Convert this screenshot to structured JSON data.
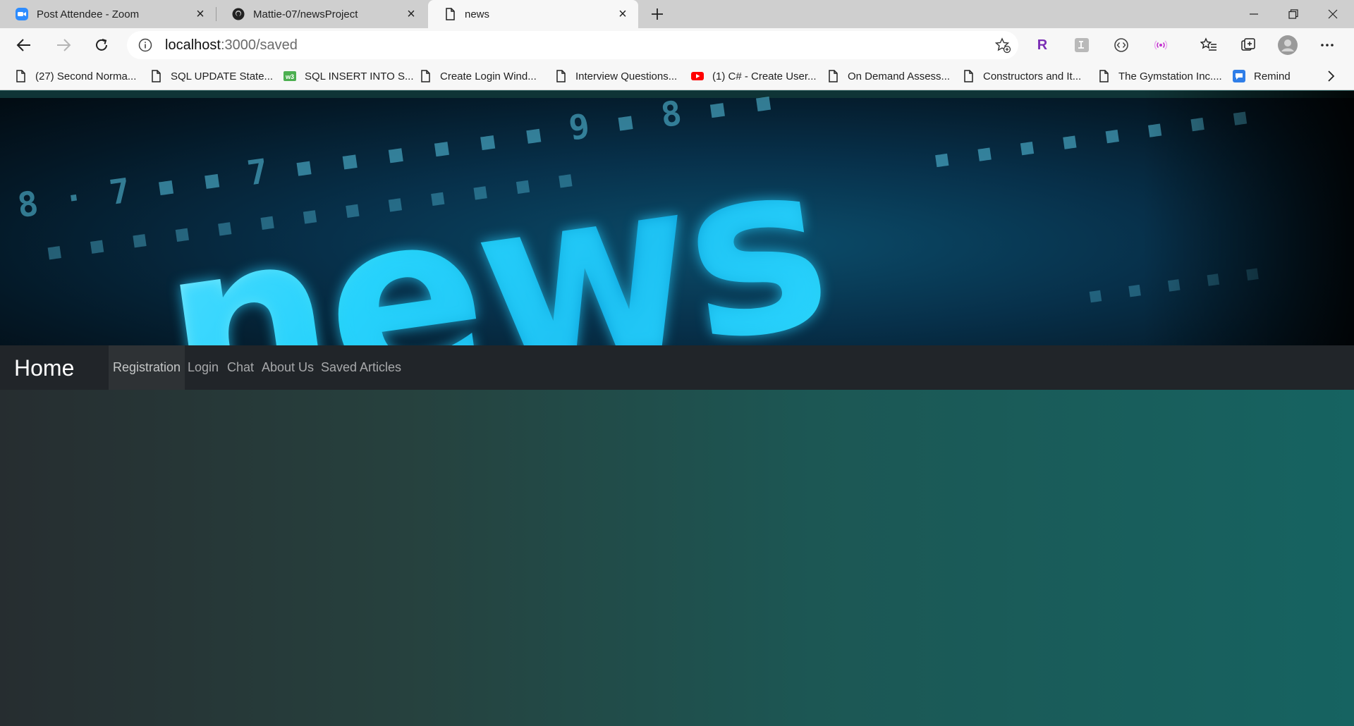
{
  "browser": {
    "tabs": [
      {
        "title": "Post Attendee - Zoom",
        "icon": "zoom-icon"
      },
      {
        "title": "Mattie-07/newsProject",
        "icon": "github-icon"
      },
      {
        "title": "news",
        "icon": "page-icon"
      }
    ],
    "address": {
      "host": "localhost",
      "path": ":3000/saved"
    },
    "bookmarks": [
      {
        "label": "(27) Second Norma...",
        "icon": "page-icon"
      },
      {
        "label": "SQL UPDATE State...",
        "icon": "page-icon"
      },
      {
        "label": "SQL INSERT INTO S...",
        "icon": "w3-icon"
      },
      {
        "label": "Create Login Wind...",
        "icon": "page-icon"
      },
      {
        "label": "Interview Questions...",
        "icon": "page-icon"
      },
      {
        "label": "(1) C# - Create User...",
        "icon": "youtube-icon"
      },
      {
        "label": "On Demand Assess...",
        "icon": "page-icon"
      },
      {
        "label": "Constructors and It...",
        "icon": "page-icon"
      },
      {
        "label": "The Gymstation Inc....",
        "icon": "page-icon"
      },
      {
        "label": "Remind",
        "icon": "remind-icon"
      }
    ]
  },
  "site": {
    "brand": "Home",
    "nav": [
      {
        "label": "Registration",
        "active": true
      },
      {
        "label": "Login"
      },
      {
        "label": "Chat"
      },
      {
        "label": "About Us"
      },
      {
        "label": "Saved Articles"
      }
    ],
    "banner_word": "news",
    "colors": {
      "navbar": "#212529",
      "accent": "#21c8ea"
    }
  }
}
